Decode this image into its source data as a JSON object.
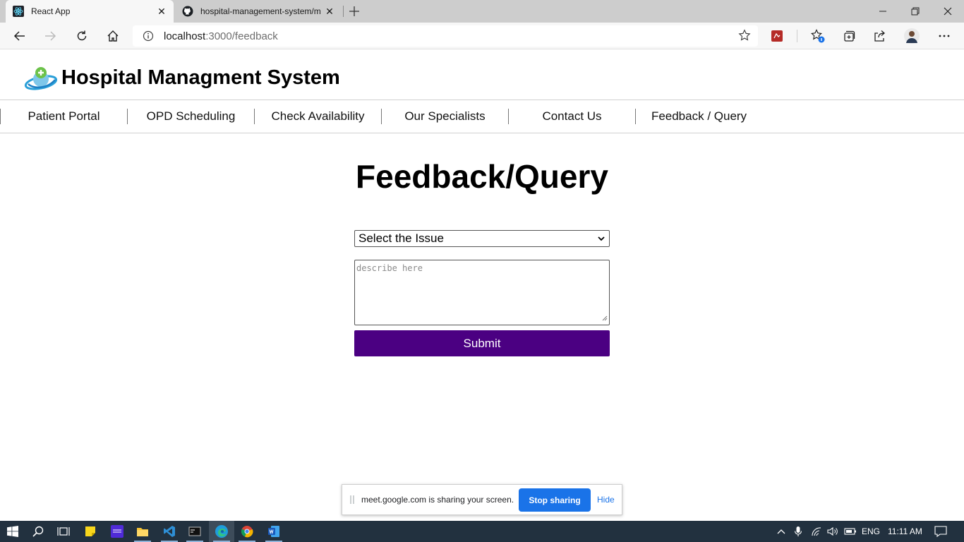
{
  "browser": {
    "tabs": [
      {
        "title": "React App",
        "active": true,
        "icon": "react-icon"
      },
      {
        "title": "hospital-management-system/m",
        "active": false,
        "icon": "github-icon"
      }
    ],
    "address": {
      "host": "localhost",
      "path": ":3000/feedback"
    }
  },
  "site": {
    "title": "Hospital Managment System",
    "nav": [
      "Patient Portal",
      "OPD Scheduling",
      "Check Availability",
      "Our Specialists",
      "Contact Us",
      "Feedback / Query"
    ]
  },
  "form": {
    "heading": "Feedback/Query",
    "select_value": "Select the Issue",
    "textarea_placeholder": "describe here",
    "submit_label": "Submit",
    "accent_color": "#4b0082"
  },
  "share_bar": {
    "message": "meet.google.com is sharing your screen.",
    "stop_label": "Stop sharing",
    "hide_label": "Hide"
  },
  "taskbar": {
    "language": "ENG",
    "time": "11:11 AM"
  }
}
